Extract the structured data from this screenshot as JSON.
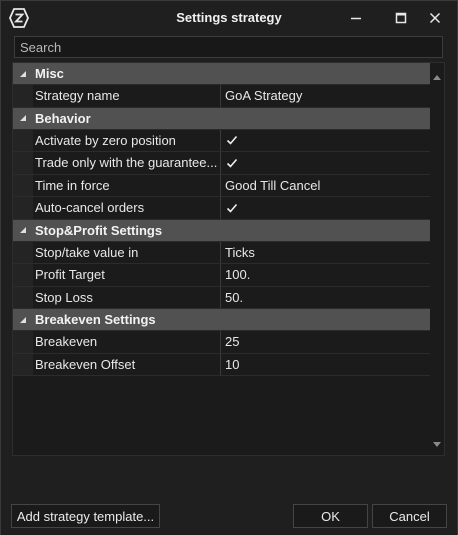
{
  "window": {
    "title": "Settings strategy",
    "logo_icon": "app-logo-icon",
    "minimize_icon": "minimize-icon",
    "maximize_icon": "maximize-icon",
    "close_icon": "close-icon"
  },
  "search": {
    "placeholder": "Search",
    "value": ""
  },
  "categories": [
    {
      "label": "Misc",
      "expanded": true,
      "properties": [
        {
          "name": "Strategy name",
          "value": "GoA Strategy",
          "type": "text"
        }
      ]
    },
    {
      "label": "Behavior",
      "expanded": true,
      "properties": [
        {
          "name": "Activate by zero position",
          "value": "",
          "type": "checkbox",
          "checked": true
        },
        {
          "name": "Trade only with the guarantee...",
          "value": "",
          "type": "checkbox",
          "checked": true
        },
        {
          "name": "Time in force",
          "value": "Good Till Cancel",
          "type": "text"
        },
        {
          "name": "Auto-cancel orders",
          "value": "",
          "type": "checkbox",
          "checked": true
        }
      ]
    },
    {
      "label": "Stop&Profit Settings",
      "expanded": true,
      "properties": [
        {
          "name": "Stop/take value in",
          "value": "Ticks",
          "type": "text"
        },
        {
          "name": "Profit Target",
          "value": "100.",
          "type": "text"
        },
        {
          "name": "Stop Loss",
          "value": "50.",
          "type": "text"
        }
      ]
    },
    {
      "label": "Breakeven Settings",
      "expanded": true,
      "properties": [
        {
          "name": "Breakeven",
          "value": "25",
          "type": "text"
        },
        {
          "name": "Breakeven Offset",
          "value": "10",
          "type": "text"
        }
      ]
    }
  ],
  "footer": {
    "add_template_label": "Add strategy template...",
    "ok_label": "OK",
    "cancel_label": "Cancel"
  },
  "colors": {
    "background": "#1f1f1f",
    "category_header": "#515151",
    "text": "#e6e6e6"
  }
}
